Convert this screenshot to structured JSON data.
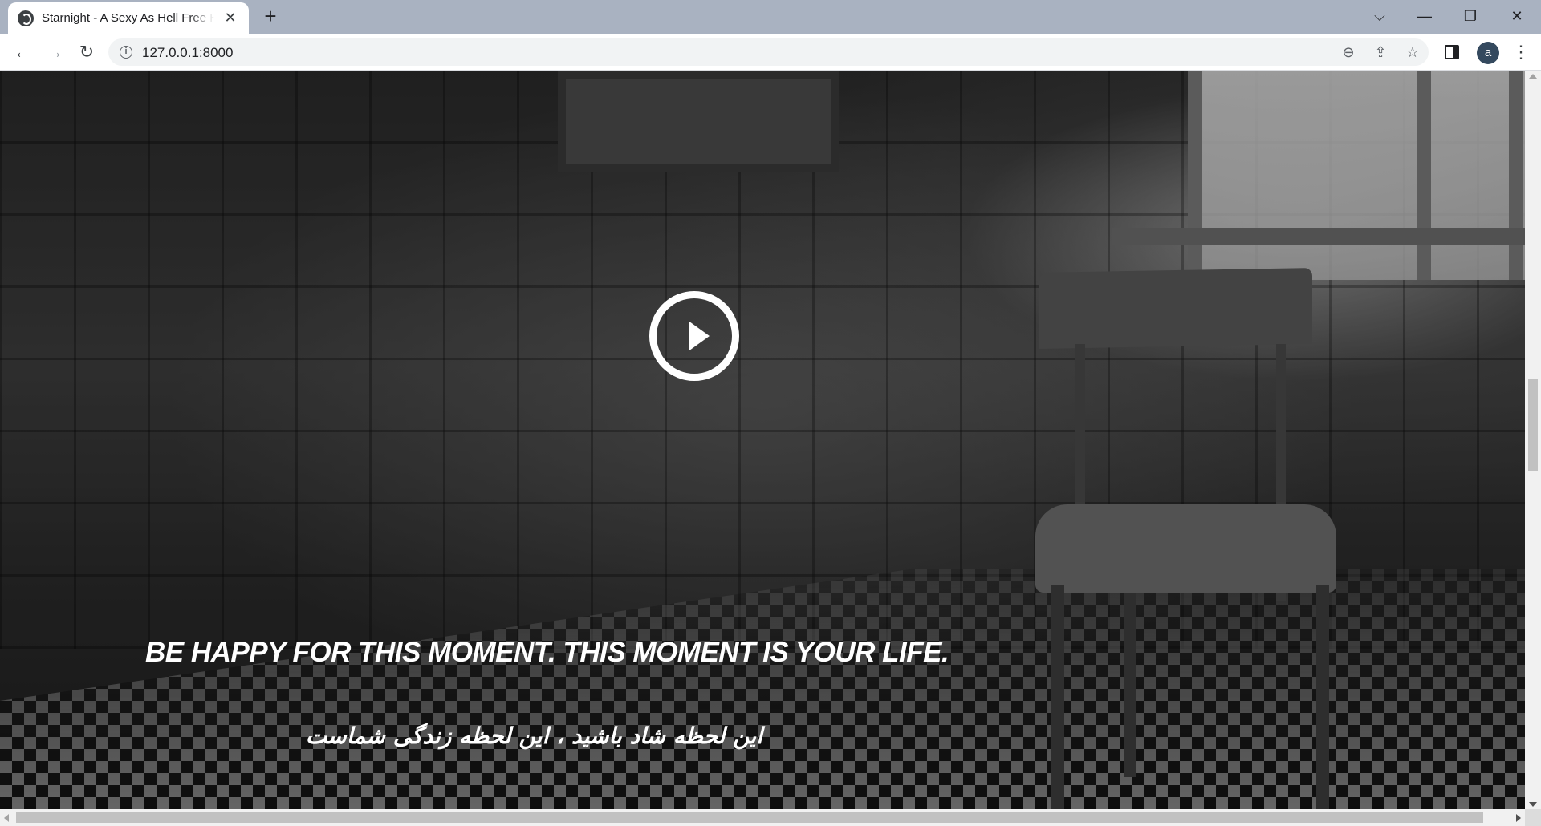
{
  "browser": {
    "tab": {
      "title": "Starnight - A Sexy As Hell Free HTML",
      "close_label": "✕",
      "favicon": "globe-icon"
    },
    "new_tab_label": "+",
    "window_controls": {
      "tab_search": "⌵",
      "minimize": "—",
      "restore": "❐",
      "close": "✕"
    },
    "toolbar": {
      "back": "←",
      "forward": "→",
      "reload": "↻",
      "info_icon": "i",
      "url": "127.0.0.1:8000",
      "zoom_icon": "⊖",
      "share_icon": "⇪",
      "star_icon": "☆",
      "avatar_letter": "a",
      "menu": "⋮"
    }
  },
  "hero": {
    "quote_en": "BE HAPPY FOR THIS MOMENT. THIS MOMENT IS YOUR LIFE.",
    "quote_fa": "این لحظه شاد باشید ، این لحظه زندگی شماست",
    "play_icon": "play-icon",
    "text_color": "#ffffff"
  }
}
